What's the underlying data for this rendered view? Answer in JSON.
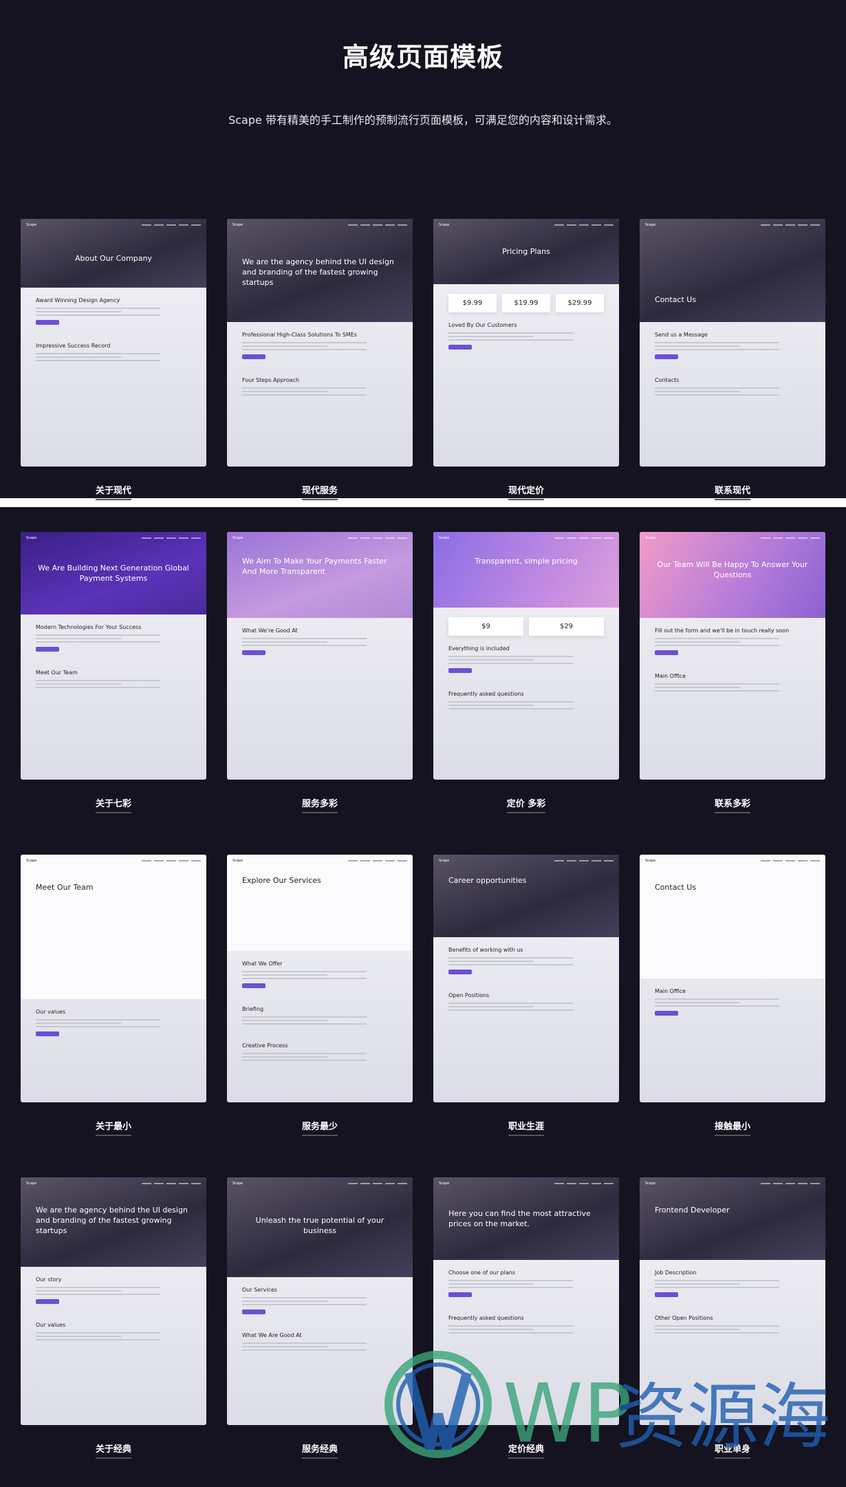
{
  "header": {
    "title": "高级页面模板",
    "subtitle": "Scape 带有精美的手工制作的预制流行页面模板，可满足您的内容和设计需求。"
  },
  "thumbnail_logo": "Scape",
  "templates": [
    {
      "label": "关于现代",
      "headline": "About Our Company",
      "sections": [
        "Award Winning Design Agency",
        "Impressive Success Record"
      ]
    },
    {
      "label": "现代服务",
      "headline": "We are the agency behind the UI design and branding of the fastest growing startups",
      "sections": [
        "Professional High-Class Solutions To SMEs",
        "Four Steps Approach"
      ]
    },
    {
      "label": "现代定价",
      "headline": "Pricing Plans",
      "prices": [
        "$9.99",
        "$19.99",
        "$29.99"
      ],
      "sections": [
        "Loved By Our Customers"
      ]
    },
    {
      "label": "联系现代",
      "headline": "Contact Us",
      "sections": [
        "Send us a Message",
        "Contacts"
      ]
    },
    {
      "label": "关于七彩",
      "headline": "We Are Building Next Generation Global Payment Systems",
      "sections": [
        "Modern Technologies For Your Success",
        "Meet Our Team"
      ]
    },
    {
      "label": "服务多彩",
      "headline": "We Aim To Make Your Payments Faster And More Transparent",
      "sections": [
        "What We're Good At"
      ]
    },
    {
      "label": "定价 多彩",
      "headline": "Transparent, simple pricing",
      "prices": [
        "$9",
        "$29"
      ],
      "sections": [
        "Everything is included",
        "Frequently asked questions"
      ]
    },
    {
      "label": "联系多彩",
      "headline": "Our Team Will Be Happy To Answer Your Questions",
      "sections": [
        "Fill out the form and we'll be in touch really soon",
        "Main Office"
      ]
    },
    {
      "label": "关于最小",
      "headline": "Meet Our Team",
      "sections": [
        "Our values"
      ]
    },
    {
      "label": "服务最少",
      "headline": "Explore Our Services",
      "sections": [
        "What We Offer",
        "Briefing",
        "Creative Process"
      ]
    },
    {
      "label": "职业生涯",
      "headline": "Career opportunities",
      "sections": [
        "Benefits of working with us",
        "Open Positions"
      ]
    },
    {
      "label": "接触最小",
      "headline": "Contact Us",
      "sections": [
        "Main Office"
      ]
    },
    {
      "label": "关于经典",
      "headline": "We are the agency behind the UI design and branding of the fastest growing startups",
      "sections": [
        "Our story",
        "Our values"
      ]
    },
    {
      "label": "服务经典",
      "headline": "Unleash the true potential of your business",
      "sections": [
        "Our Services",
        "What We Are Good At"
      ]
    },
    {
      "label": "定价经典",
      "headline": "Here you can find the most attractive prices on the market.",
      "sections": [
        "Choose one of our plans",
        "Frequently asked questions"
      ]
    },
    {
      "label": "职业单身",
      "headline": "Frontend Developer",
      "sections": [
        "Job Description",
        "Other Open Positions"
      ]
    }
  ],
  "watermark": {
    "text": "WP资源海",
    "colors": {
      "green": "#3aa57a",
      "blue": "#1f5fb0"
    }
  },
  "colors": {
    "background": "#14131f",
    "accent": "#6c4fd6"
  }
}
